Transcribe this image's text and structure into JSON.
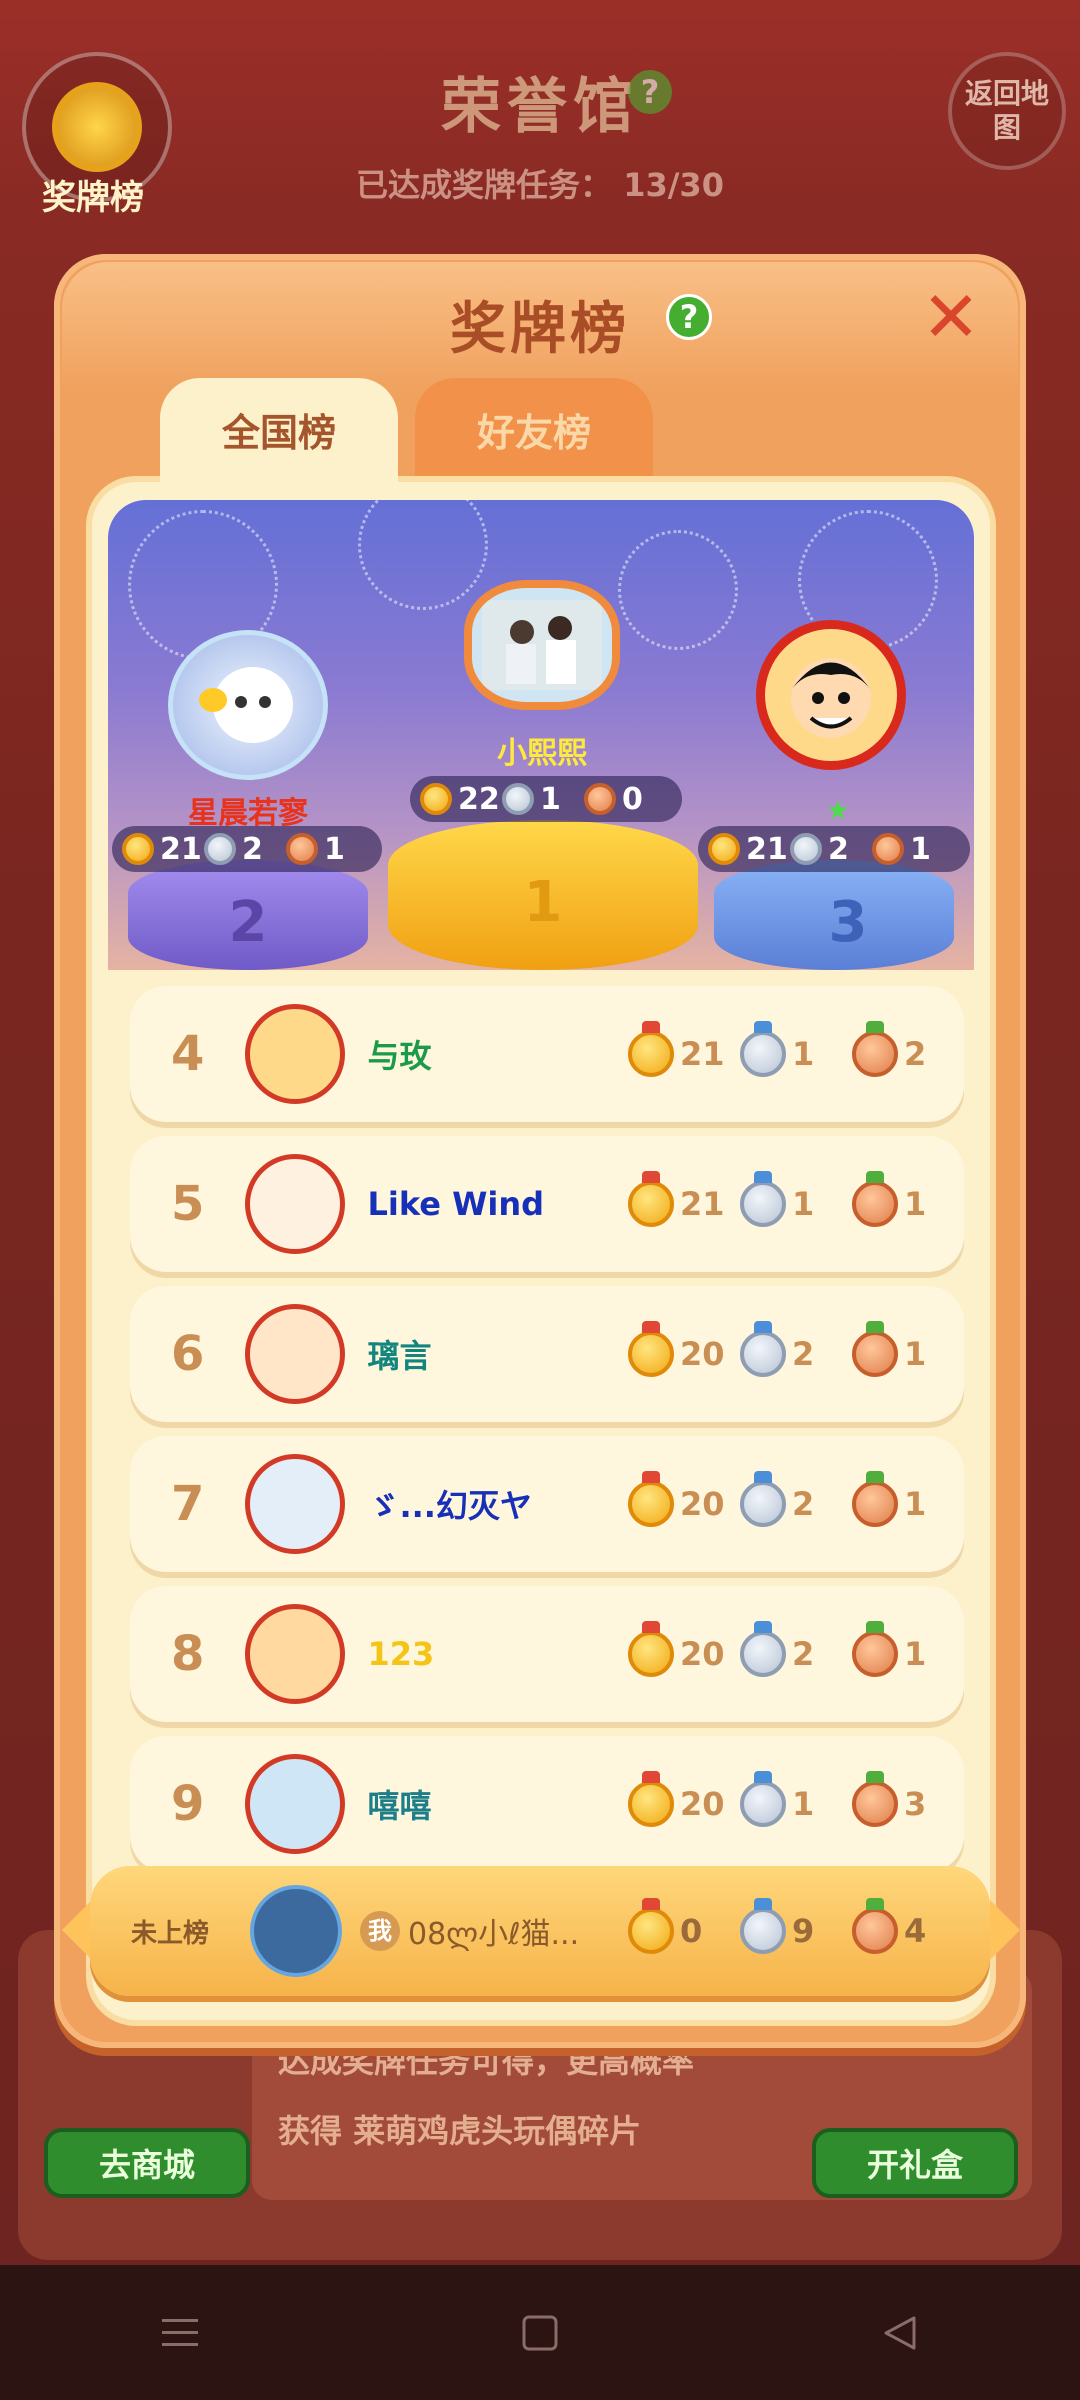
{
  "background": {
    "medal_button_label": "奖牌榜",
    "title": "荣誉馆",
    "help_glyph": "?",
    "progress_label": "已达成奖牌任务：",
    "progress_value": "13/30",
    "return_button": "返回地图",
    "bottom_text_1": "达成奖牌任务可得",
    "bottom_text_1b": "，更高概率",
    "bottom_text_2": "获得 莱萌鸡虎头玩偶碎片",
    "shop_button": "去商城",
    "giftbox_button": "开礼盒"
  },
  "modal": {
    "title": "奖牌榜",
    "help_glyph": "?",
    "close_glyph": "✕",
    "tabs": [
      {
        "label": "全国榜",
        "active": true
      },
      {
        "label": "好友榜",
        "active": false
      }
    ]
  },
  "podium": [
    {
      "rank": "1",
      "name": "小熙熙",
      "gold": "22",
      "silver": "1",
      "bronze": "0",
      "name_color": "#ffe93c"
    },
    {
      "rank": "2",
      "name": "星晨若寥",
      "gold": "21",
      "silver": "2",
      "bronze": "1",
      "name_color": "#e8321c"
    },
    {
      "rank": "3",
      "name": "",
      "gold": "21",
      "silver": "2",
      "bronze": "1",
      "name_color": "#ffffff"
    }
  ],
  "rows": [
    {
      "rank": "4",
      "name": "与玫",
      "gold": "21",
      "silver": "1",
      "bronze": "2",
      "name_color": "#1b9a4a"
    },
    {
      "rank": "5",
      "name": "Like Wind",
      "gold": "21",
      "silver": "1",
      "bronze": "1",
      "name_color": "#1730b8"
    },
    {
      "rank": "6",
      "name": "璃言",
      "gold": "20",
      "silver": "2",
      "bronze": "1",
      "name_color": "#12867d"
    },
    {
      "rank": "7",
      "name": "ゞ...幻灭ヤ",
      "gold": "20",
      "silver": "2",
      "bronze": "1",
      "name_color": "#1730b8"
    },
    {
      "rank": "8",
      "name": "123",
      "gold": "20",
      "silver": "2",
      "bronze": "1",
      "name_color": "#f4c416"
    },
    {
      "rank": "9",
      "name": "嘻嘻",
      "gold": "20",
      "silver": "1",
      "bronze": "3",
      "name_color": "#1b7e88"
    }
  ],
  "self": {
    "status": "未上榜",
    "me_badge": "我",
    "name": "08ლ小ℓ猫...",
    "gold": "0",
    "silver": "9",
    "bronze": "4"
  },
  "icons": {
    "gold_medal": "gold-medal-icon",
    "silver_medal": "silver-medal-icon",
    "bronze_medal": "bronze-medal-icon"
  }
}
